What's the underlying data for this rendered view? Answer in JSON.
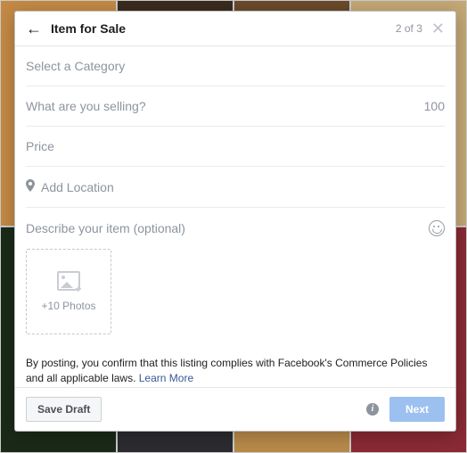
{
  "header": {
    "title": "Item for Sale",
    "step_counter": "2 of 3"
  },
  "fields": {
    "category_placeholder": "Select a Category",
    "selling_placeholder": "What are you selling?",
    "char_remaining": "100",
    "price_placeholder": "Price",
    "location_placeholder": "Add Location",
    "description_label": "Describe your item (optional)"
  },
  "photos": {
    "add_label": "+10 Photos"
  },
  "terms": {
    "text_prefix": "By posting, you confirm that this listing complies with Facebook's Commerce Policies and all applicable laws. ",
    "link_text": "Learn More"
  },
  "footer": {
    "save_draft": "Save Draft",
    "next": "Next"
  }
}
